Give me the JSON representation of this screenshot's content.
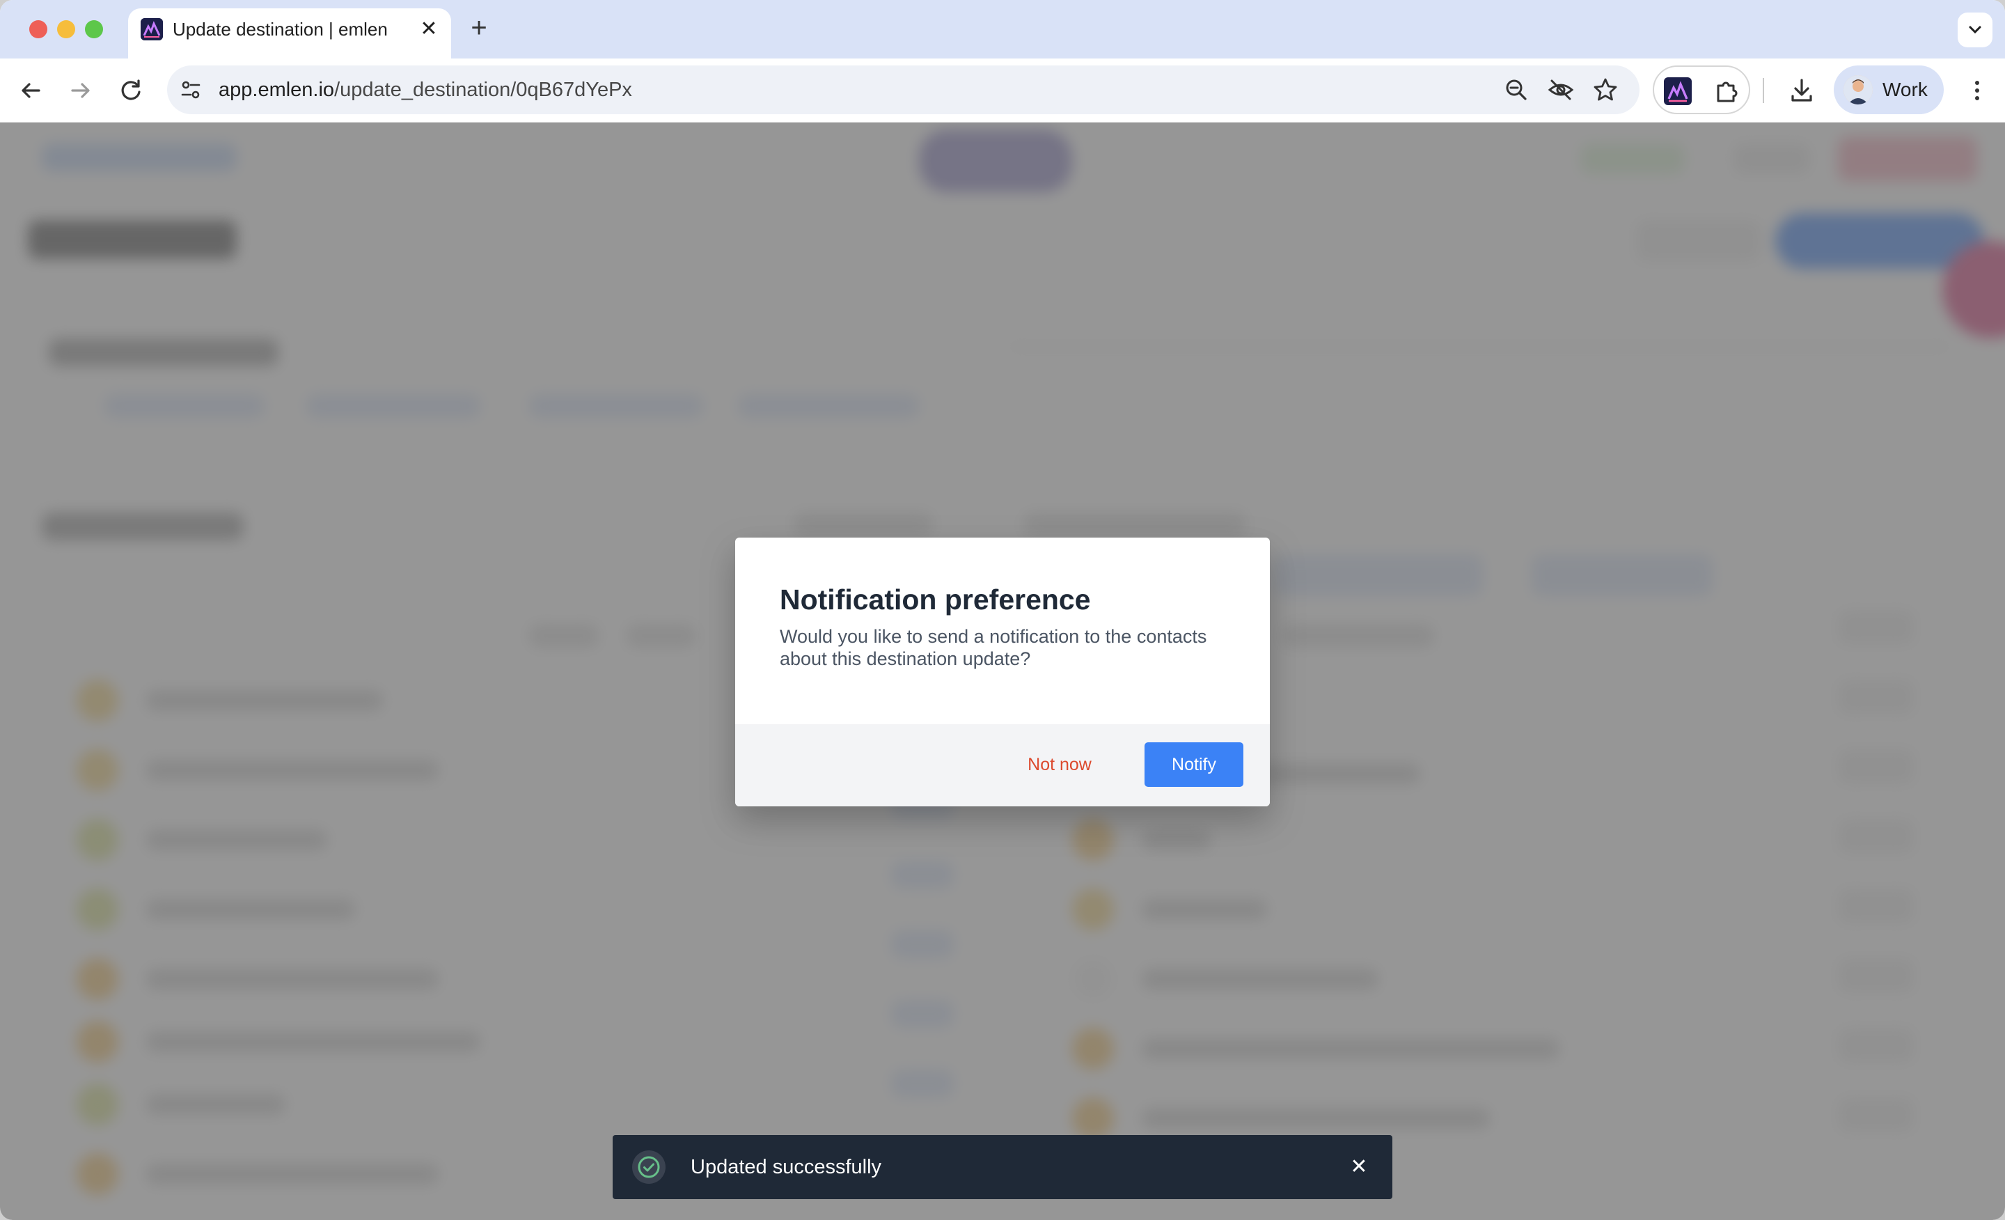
{
  "browser": {
    "tab": {
      "title": "Update destination | emlen",
      "favicon": "emlen-logo-icon",
      "close_icon": "close-icon"
    },
    "new_tab_icon": "plus-icon",
    "tab_list_icon": "chevron-down-icon",
    "nav": {
      "back_icon": "arrow-left-icon",
      "forward_icon": "arrow-right-icon",
      "reload_icon": "reload-icon"
    },
    "address_bar": {
      "domain": "app.emlen.io",
      "path": "/update_destination/0qB67dYePx",
      "site_info_icon": "tune-icon",
      "icons": [
        "zoom-out-icon",
        "eye-off-icon",
        "star-icon"
      ]
    },
    "extensions": [
      "emlen-extension-icon",
      "puzzle-icon"
    ],
    "download_icon": "download-icon",
    "profile": {
      "label": "Work"
    },
    "menu_icon": "kebab-menu-icon"
  },
  "modal": {
    "title": "Notification preference",
    "body": "Would you like to send a notification to the contacts about this destination update?",
    "secondary_label": "Not now",
    "primary_label": "Notify"
  },
  "toast": {
    "message": "Updated successfully",
    "icon": "check-circle-icon",
    "close_icon": "close-icon"
  },
  "colors": {
    "primary_button": "#3b82f6",
    "secondary_text": "#dc4a2e",
    "toast_bg": "#1f2937",
    "tabstrip_bg": "#d9e2f7"
  }
}
